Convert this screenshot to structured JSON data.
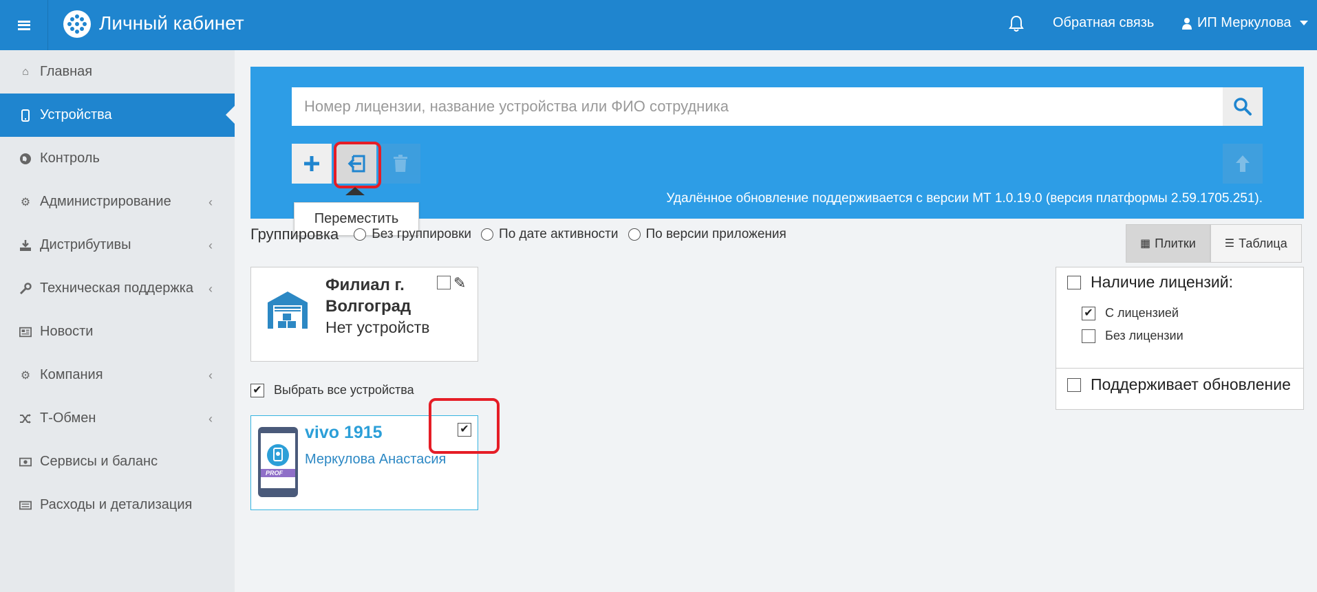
{
  "header": {
    "title": "Личный кабинет",
    "feedback": "Обратная связь",
    "user": "ИП Меркулова"
  },
  "sidebar": {
    "items": [
      {
        "label": "Главная",
        "icon": "home-icon"
      },
      {
        "label": "Устройства",
        "icon": "mobile-icon",
        "active": true
      },
      {
        "label": "Контроль",
        "icon": "globe-icon"
      },
      {
        "label": "Администрирование",
        "icon": "gears-icon",
        "chevron": true
      },
      {
        "label": "Дистрибутивы",
        "icon": "download-icon",
        "chevron": true
      },
      {
        "label": "Техническая поддержка",
        "icon": "wrench-icon",
        "chevron": true
      },
      {
        "label": "Новости",
        "icon": "newspaper-icon"
      },
      {
        "label": "Компания",
        "icon": "gear-icon",
        "chevron": true
      },
      {
        "label": "Т-Обмен",
        "icon": "shuffle-icon",
        "chevron": true
      },
      {
        "label": "Сервисы и баланс",
        "icon": "money-icon"
      },
      {
        "label": "Расходы и детализация",
        "icon": "list-icon"
      }
    ]
  },
  "search": {
    "placeholder": "Номер лицензии, название устройства или ФИО сотрудника"
  },
  "toolbar": {
    "tooltip": "Переместить",
    "update_note": "Удалённое обновление поддерживается с версии МТ 1.0.19.0 (версия платформы 2.59.1705.251)."
  },
  "grouping": {
    "label": "Группировка",
    "options": [
      "Без группировки",
      "По дате активности",
      "По версии приложения"
    ]
  },
  "view": {
    "tiles": "Плитки",
    "table": "Таблица"
  },
  "group_card": {
    "name": "Филиал г. Волгоград",
    "status": "Нет устройств"
  },
  "select_all": {
    "label": "Выбрать все устройства",
    "checked": true
  },
  "device": {
    "name": "vivo 1915",
    "user": "Меркулова Анастасия",
    "badge": "PROF",
    "checked": true
  },
  "filters": {
    "licenses_title": "Наличие лицензий:",
    "with_license": "С лицензией",
    "without_license": "Без лицензии",
    "update_title": "Поддерживает обновление"
  },
  "colors": {
    "header": "#1f85cf",
    "panel": "#2d9de6",
    "highlight": "#e51d26",
    "device_border": "#34b3e0"
  }
}
